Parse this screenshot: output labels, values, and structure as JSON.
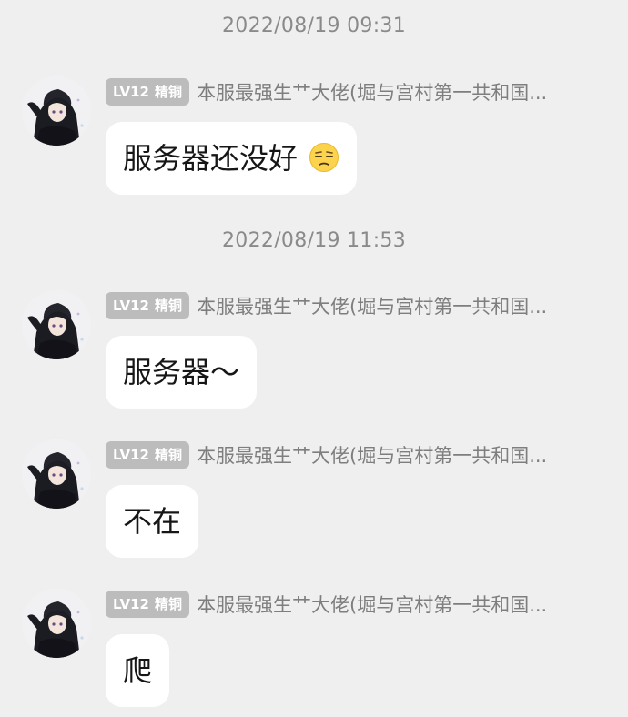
{
  "timestamps": [
    "2022/08/19 09:31",
    "2022/08/19 11:53"
  ],
  "sender": {
    "level": "LV12",
    "title": "精铜",
    "name": "本服最强生艹大佬(堀与宫村第一共和国..."
  },
  "messages": [
    {
      "text": "服务器还没好",
      "emoji": "unamused-face-icon"
    },
    {
      "text": "服务器～"
    },
    {
      "text": "不在"
    },
    {
      "text": "爬"
    }
  ]
}
